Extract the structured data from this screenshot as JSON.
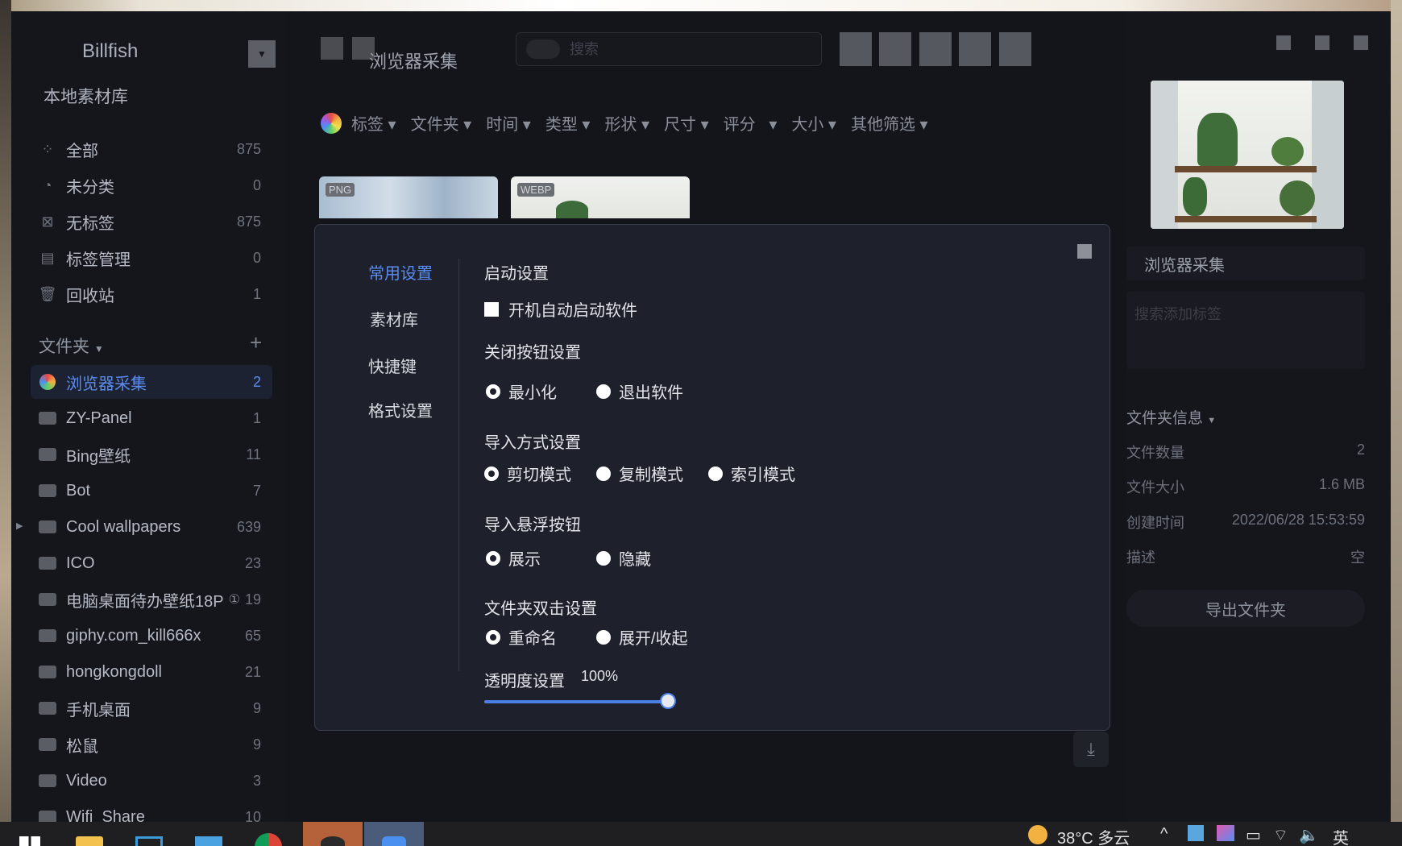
{
  "app": {
    "name": "Billfish",
    "library_title": "本地素材库"
  },
  "sidebar": {
    "nav": [
      {
        "label": "全部",
        "count": "875",
        "icon": "grid-icon"
      },
      {
        "label": "未分类",
        "count": "0",
        "icon": "pie-icon"
      },
      {
        "label": "无标签",
        "count": "875",
        "icon": "no-tag-icon"
      },
      {
        "label": "标签管理",
        "count": "0",
        "icon": "tag-manage-icon"
      },
      {
        "label": "回收站",
        "count": "1",
        "icon": "trash-icon"
      }
    ],
    "folders_header": "文件夹",
    "folders": [
      {
        "label": "浏览器采集",
        "count": "2",
        "active": true
      },
      {
        "label": "ZY-Panel",
        "count": "1"
      },
      {
        "label": "Bing壁纸",
        "count": "11"
      },
      {
        "label": "Bot",
        "count": "7"
      },
      {
        "label": "Cool wallpapers",
        "count": "639",
        "expandable": true
      },
      {
        "label": "ICO",
        "count": "23"
      },
      {
        "label": "电脑桌面待办壁纸18P",
        "count": "19",
        "badge": "①"
      },
      {
        "label": "giphy.com_kill666x",
        "count": "65"
      },
      {
        "label": "hongkongdoll",
        "count": "21"
      },
      {
        "label": "手机桌面",
        "count": "9"
      },
      {
        "label": "松鼠",
        "count": "9"
      },
      {
        "label": "Video",
        "count": "3"
      },
      {
        "label": "Wifi_Share",
        "count": "10"
      }
    ]
  },
  "main": {
    "title": "浏览器采集",
    "search_placeholder": "搜索",
    "filters": [
      "标签",
      "文件夹",
      "时间",
      "类型",
      "形状",
      "尺寸",
      "评分",
      "大小",
      "其他筛选"
    ],
    "thumbs": [
      {
        "format": "PNG"
      },
      {
        "format": "WEBP"
      }
    ]
  },
  "right_panel": {
    "name": "浏览器采集",
    "tags_placeholder": "搜索添加标签",
    "info_header": "文件夹信息",
    "rows": [
      {
        "label": "文件数量",
        "value": "2"
      },
      {
        "label": "文件大小",
        "value": "1.6 MB"
      },
      {
        "label": "创建时间",
        "value": "2022/06/28 15:53:59"
      },
      {
        "label": "描述",
        "value": "空"
      }
    ],
    "export_label": "导出文件夹"
  },
  "settings": {
    "nav": [
      "常用设置",
      "素材库",
      "快捷键",
      "格式设置"
    ],
    "startup": {
      "title": "启动设置",
      "option": "开机自动启动软件",
      "checked": false
    },
    "close_btn": {
      "title": "关闭按钮设置",
      "options": [
        "最小化",
        "退出软件"
      ],
      "selected": 0
    },
    "import_mode": {
      "title": "导入方式设置",
      "options": [
        "剪切模式",
        "复制模式",
        "索引模式"
      ],
      "selected": 0
    },
    "float_btn": {
      "title": "导入悬浮按钮",
      "options": [
        "展示",
        "隐藏"
      ],
      "selected": 0
    },
    "dblclick": {
      "title": "文件夹双击设置",
      "options": [
        "重命名",
        "展开/收起"
      ],
      "selected": 0
    },
    "opacity": {
      "title": "透明度设置",
      "value_label": "100%",
      "value": 1.0
    }
  },
  "taskbar": {
    "weather": "38°C 多云",
    "ime": "英"
  },
  "colors": {
    "accent": "#5a8cf2",
    "bg": "#15161c",
    "modal": "#1e202b"
  }
}
